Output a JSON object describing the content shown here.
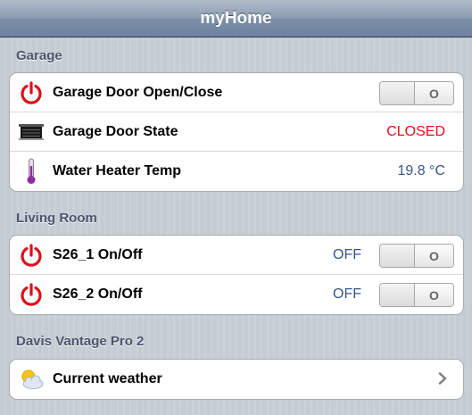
{
  "title": "myHome",
  "sections": [
    {
      "title": "Garage",
      "rows": [
        {
          "label": "Garage Door Open/Close",
          "icon": "power-icon",
          "switch": "O"
        },
        {
          "label": "Garage Door State",
          "icon": "garage-door-icon",
          "value": "CLOSED"
        },
        {
          "label": "Water Heater Temp",
          "icon": "thermometer-icon",
          "value": "19.8 °C"
        }
      ]
    },
    {
      "title": "Living Room",
      "rows": [
        {
          "label": "S26_1 On/Off",
          "icon": "power-icon",
          "value": "OFF",
          "switch": "O"
        },
        {
          "label": "S26_2 On/Off",
          "icon": "power-icon",
          "value": "OFF",
          "switch": "O"
        }
      ]
    },
    {
      "title": "Davis Vantage Pro 2",
      "rows": [
        {
          "label": "Current weather",
          "icon": "sun-cloud-icon"
        }
      ]
    }
  ],
  "colors": {
    "accent_value": "#385487",
    "closed_value": "#e0101b",
    "power_icon": "#d9101a"
  }
}
